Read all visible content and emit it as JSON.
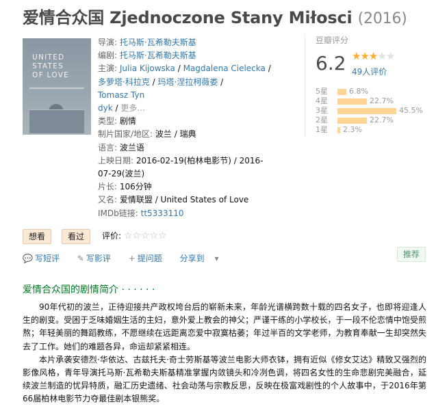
{
  "title": {
    "chinese": "爱情合众国",
    "original": "Zjednoczone Stany Miłosci",
    "year": "(2016)"
  },
  "poster": {
    "text": [
      "UNITED",
      "STATES",
      "OF LOVE"
    ]
  },
  "info": {
    "director_label": "导演:",
    "director": "托马斯·瓦希勒夫斯基",
    "writer_label": "编剧:",
    "writer": "托马斯·瓦希勒夫斯基",
    "cast_label": "主演:",
    "cast": [
      "Julia Kijowska",
      "Magdalena Cielecka",
      "多萝塔·科拉克",
      "玛塔·涅拉柯薇娄",
      "Tomasz Tyndyk"
    ],
    "cast_more": "更多...",
    "genre_label": "类型:",
    "genre": "剧情",
    "country_label": "制片国家/地区:",
    "country": "波兰 / 瑞典",
    "language_label": "语言:",
    "language": "波兰语",
    "release_label": "上映日期:",
    "release": "2016-02-19(柏林电影节) / 2016-07-29(波兰)",
    "runtime_label": "片长:",
    "runtime": "106分钟",
    "aka_label": "又名:",
    "aka": "爱情联盟 / United States of Love",
    "imdb_label": "IMDb链接:",
    "imdb": "tt5333110"
  },
  "rating": {
    "label": "豆瓣评分",
    "score": "6.2",
    "stars_on": 3,
    "people": "49人评价",
    "breakdown": [
      {
        "star": "5星",
        "pct": "6.8%",
        "value": 6.8
      },
      {
        "star": "4星",
        "pct": "22.7%",
        "value": 22.7
      },
      {
        "star": "3星",
        "pct": "45.5%",
        "value": 45.5
      },
      {
        "star": "2星",
        "pct": "22.7%",
        "value": 22.7
      },
      {
        "star": "1星",
        "pct": "2.3%",
        "value": 2.3
      }
    ],
    "bar_color": "#ffd596",
    "star_color": "#ffac2d"
  },
  "buttons": {
    "want": "想看",
    "seen": "看过",
    "my_rating_label": "评价:"
  },
  "actions": {
    "short_review": "写短评",
    "review": "写影评",
    "question": "提问题",
    "share": "分享到"
  },
  "recommend": "推荐",
  "synopsis": {
    "title": "爱情合众国的剧情简介 · · · · · ·",
    "p1": "90年代初的波兰，正待迎接共产政权垮台后的崭新未来，年龄光谱横跨数十载的四名女子，也即将迎逢人生的剧变。受困于乏味婚姻生活的主妇，意外爱上教会的神父；严谨干练的小学校长，于一段不伦恋情中饱受煎熬；年轻美丽的舞蹈教练，不愿继续在远距离恋爱中寂寞枯萎；年过半百的文学老师，为教育奉献一生却突然失去了工作。她们的难题各异，命运却紧紧相连。",
    "p2": "本片承袭安德烈·华依达、古兹托夫·奇士劳斯基等波兰电影大师衣钵，拥有近似《修女艾达》精致又强烈的影像风格，青年导演托马斯·瓦希勒夫斯基精准掌握内敛镜头和冷冽色调，将四名女性的生命悲剧完美融合，延续波兰制造的忧异特质，融汇历史遗绪、社会动荡与宗教反思，反映在极富戏剧性的个人故事中，于2016年第66届柏林电影节力夺最佳剧本银熊奖。"
  }
}
